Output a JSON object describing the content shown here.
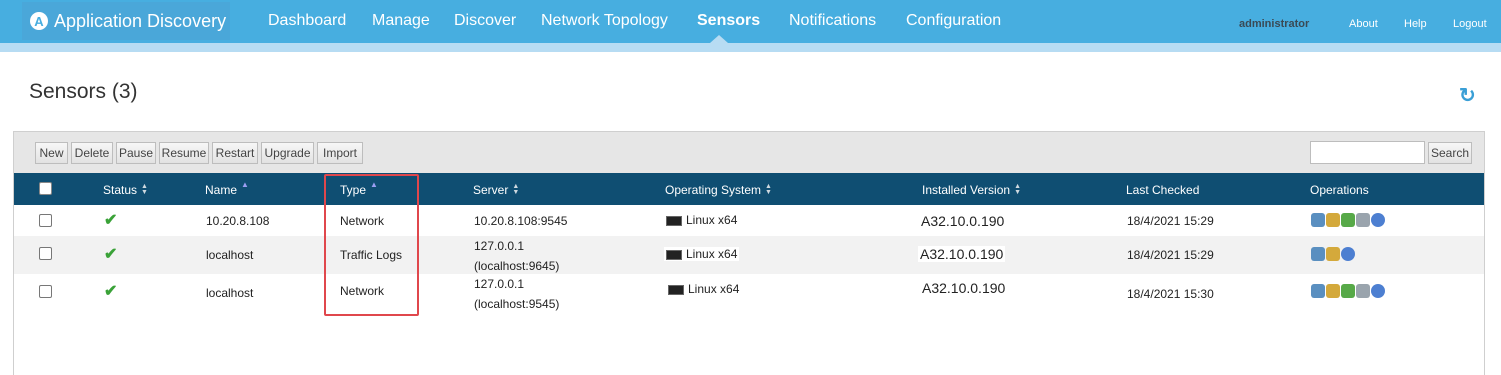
{
  "app": {
    "title": "Application Discovery",
    "logo_letter": "A"
  },
  "nav": {
    "items": [
      {
        "label": "Dashboard"
      },
      {
        "label": "Manage"
      },
      {
        "label": "Discover"
      },
      {
        "label": "Network Topology"
      },
      {
        "label": "Sensors"
      },
      {
        "label": "Notifications"
      },
      {
        "label": "Configuration"
      }
    ],
    "active": "Sensors",
    "user": "administrator",
    "about": "About",
    "help": "Help",
    "logout": "Logout"
  },
  "page": {
    "title": "Sensors (3)",
    "refresh_icon": "↻"
  },
  "toolbar": {
    "buttons": [
      "New",
      "Delete",
      "Pause",
      "Resume",
      "Restart",
      "Upgrade",
      "Import"
    ],
    "search_label": "Search",
    "search_value": ""
  },
  "table": {
    "headers": {
      "status": "Status",
      "name": "Name",
      "type": "Type",
      "server": "Server",
      "os": "Operating System",
      "version": "Installed Version",
      "last_checked": "Last Checked",
      "operations": "Operations"
    },
    "rows": [
      {
        "status_icon": "✔",
        "name": "10.20.8.108",
        "type": "Network",
        "server_line1": "10.20.8.108:9545",
        "server_line2": "",
        "os": "Linux x64",
        "version": "A32.10.0.190",
        "last_checked": "18/4/2021 15:29"
      },
      {
        "status_icon": "✔",
        "name": "localhost",
        "type": "Traffic Logs",
        "server_line1": "127.0.0.1",
        "server_line2": "(localhost:9645)",
        "os": "Linux x64",
        "version": "A32.10.0.190",
        "last_checked": "18/4/2021 15:29"
      },
      {
        "status_icon": "✔",
        "name": "localhost",
        "type": "Network",
        "server_line1": "127.0.0.1",
        "server_line2": "(localhost:9545)",
        "os": "Linux x64",
        "version": "A32.10.0.190",
        "last_checked": "18/4/2021 15:30"
      }
    ]
  },
  "colors": {
    "nav_bg": "#47aee0",
    "table_header_bg": "#0f4e72",
    "highlight": "#e0474c",
    "status_ok": "#3aa238"
  },
  "icons": {
    "status": "check-icon",
    "os": "terminal-icon",
    "refresh": "refresh-icon",
    "operations": [
      "settings-icon",
      "edit-icon",
      "restart-icon",
      "upgrade-icon",
      "info-icon"
    ]
  }
}
